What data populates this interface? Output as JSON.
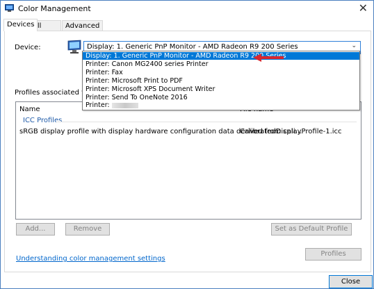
{
  "window": {
    "title": "Color Management",
    "close_glyph": "✕"
  },
  "tabs": [
    {
      "label": "Devices",
      "active": true
    },
    {
      "label": "All Profiles",
      "active": false
    },
    {
      "label": "Advanced",
      "active": false
    }
  ],
  "device": {
    "label": "Device:",
    "selected": "Display: 1. Generic PnP Monitor - AMD Radeon R9 200 Series",
    "options": [
      "Display: 1. Generic PnP Monitor - AMD Radeon R9 200 Series",
      "Printer: Canon MG2400 series Printer",
      "Printer: Fax",
      "Printer: Microsoft Print to PDF",
      "Printer: Microsoft XPS Document Writer",
      "Printer: Send To OneNote 2016",
      "Printer:"
    ]
  },
  "profiles": {
    "label": "Profiles associated with th",
    "columns": {
      "name": "Name",
      "file": "File name"
    },
    "group": "ICC Profiles",
    "rows": [
      {
        "name": "sRGB display profile with display hardware configuration data derived from cali...",
        "file": "CalibratedDisplayProfile-1.icc"
      }
    ]
  },
  "buttons": {
    "add": "Add...",
    "remove": "Remove",
    "set_default": "Set as Default Profile",
    "profiles": "Profiles",
    "close": "Close"
  },
  "link": "Understanding color management settings",
  "colors": {
    "accent": "#0078d7",
    "link": "#0066cc",
    "arrow": "#d9272e"
  }
}
